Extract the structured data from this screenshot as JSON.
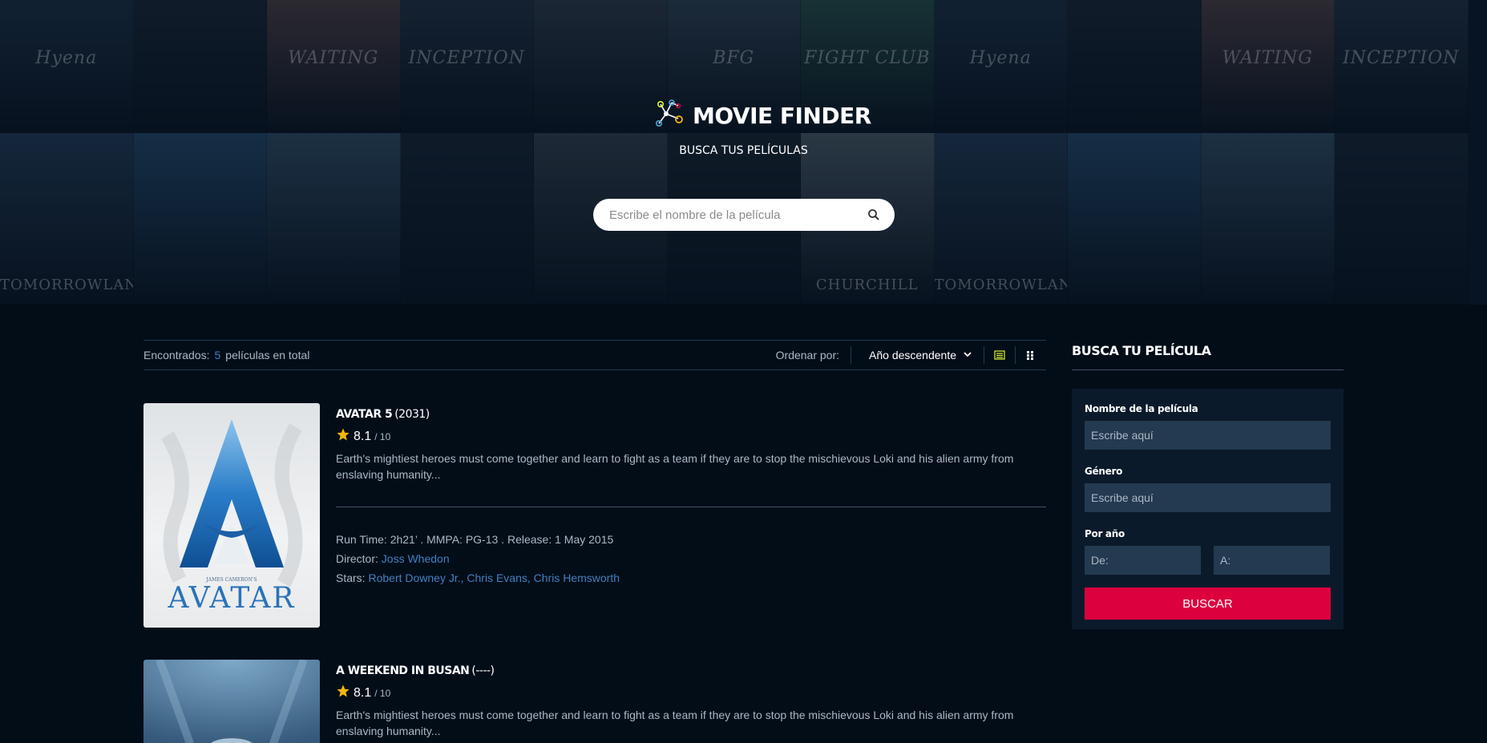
{
  "brand": {
    "title": "MOVIE FINDER",
    "subtitle": "BUSCA TUS PELÍCULAS",
    "logo_icon": "network-nodes-icon"
  },
  "hero_search": {
    "placeholder": "Escribe el nombre de la película",
    "icon": "search-icon"
  },
  "background_posters": [
    {
      "caption": "Hyena",
      "color": "#22384c",
      "pos": "top"
    },
    {
      "caption": "",
      "color": "#1f2c3a",
      "pos": "top"
    },
    {
      "caption": "WAITING",
      "color": "#5d4a4a",
      "pos": "top"
    },
    {
      "caption": "INCEPTION",
      "color": "#2a3a4a",
      "pos": "top"
    },
    {
      "caption": "",
      "color": "#3a4552",
      "pos": "top"
    },
    {
      "caption": "BFG",
      "color": "#3a4e5e",
      "pos": "top"
    },
    {
      "caption": "FIGHT CLUB",
      "color": "#2f5e52",
      "pos": "top"
    },
    {
      "caption": "Hyena",
      "color": "#22384c",
      "pos": "top"
    },
    {
      "caption": "",
      "color": "#1f2c3a",
      "pos": "top"
    },
    {
      "caption": "WAITING",
      "color": "#5d4a4a",
      "pos": "top"
    },
    {
      "caption": "INCEPTION",
      "color": "#2a3a4a",
      "pos": "top"
    },
    {
      "caption": "TOMORROWLAND",
      "color": "#2a4560",
      "pos": "bottom"
    },
    {
      "caption": "",
      "color": "#2b5678",
      "pos": "bottom"
    },
    {
      "caption": "",
      "color": "#3b5a72",
      "pos": "bottom"
    },
    {
      "caption": "",
      "color": "#1c2a38",
      "pos": "bottom"
    },
    {
      "caption": "",
      "color": "#3d4a55",
      "pos": "bottom"
    },
    {
      "caption": "",
      "color": "#1e2a35",
      "pos": "bottom"
    },
    {
      "caption": "CHURCHILL",
      "color": "#5a6a74",
      "pos": "bottom"
    },
    {
      "caption": "TOMORROWLAND",
      "color": "#2a4560",
      "pos": "bottom"
    },
    {
      "caption": "",
      "color": "#2b5678",
      "pos": "bottom"
    },
    {
      "caption": "",
      "color": "#3b5a72",
      "pos": "bottom"
    },
    {
      "caption": "",
      "color": "#1c2a38",
      "pos": "bottom"
    }
  ],
  "results": {
    "found_label": "Encontrados:",
    "count": "5",
    "count_suffix": "películas en total",
    "sort_label": "Ordenar por:",
    "sort_value": "Año descendente",
    "view_list_icon": "list-view-icon",
    "view_grid_icon": "grid-view-icon"
  },
  "movies": [
    {
      "title": "AVATAR 5",
      "year": "(2031)",
      "rating": "8.1",
      "rating_max": "/ 10",
      "description": "Earth's mightiest heroes must come together and learn to fight as a team if they are to stop the mischievous Loki and his alien army from enslaving humanity...",
      "runtime_line": "Run Time: 2h21’ . MMPA: PG-13 . Release: 1 May 2015",
      "director_label": "Director:",
      "director": "Joss Whedon",
      "stars_label": "Stars:",
      "stars": "Robert Downey Jr., Chris Evans, Chris Hemsworth",
      "poster_text": "AVATAR",
      "poster_small": "JAMES CAMERON'S"
    },
    {
      "title": "A WEEKEND IN BUSAN",
      "year": "(----)",
      "rating": "8.1",
      "rating_max": "/ 10",
      "description": "Earth's mightiest heroes must come together and learn to fight as a team if they are to stop the mischievous Loki and his alien army from enslaving humanity..."
    }
  ],
  "sidebar": {
    "title": "BUSCA TU PELÍCULA",
    "name_label": "Nombre de la película",
    "name_placeholder": "Escribe aquí",
    "genre_label": "Género",
    "genre_placeholder": "Escribe aquí",
    "year_label": "Por año",
    "from_placeholder": "De:",
    "to_placeholder": "A:",
    "submit_label": "BUSCAR"
  },
  "colors": {
    "background": "#020d18",
    "accent_blue": "#4280bf",
    "submit_red": "#dd003f",
    "rating_star": "#f5b50a"
  }
}
